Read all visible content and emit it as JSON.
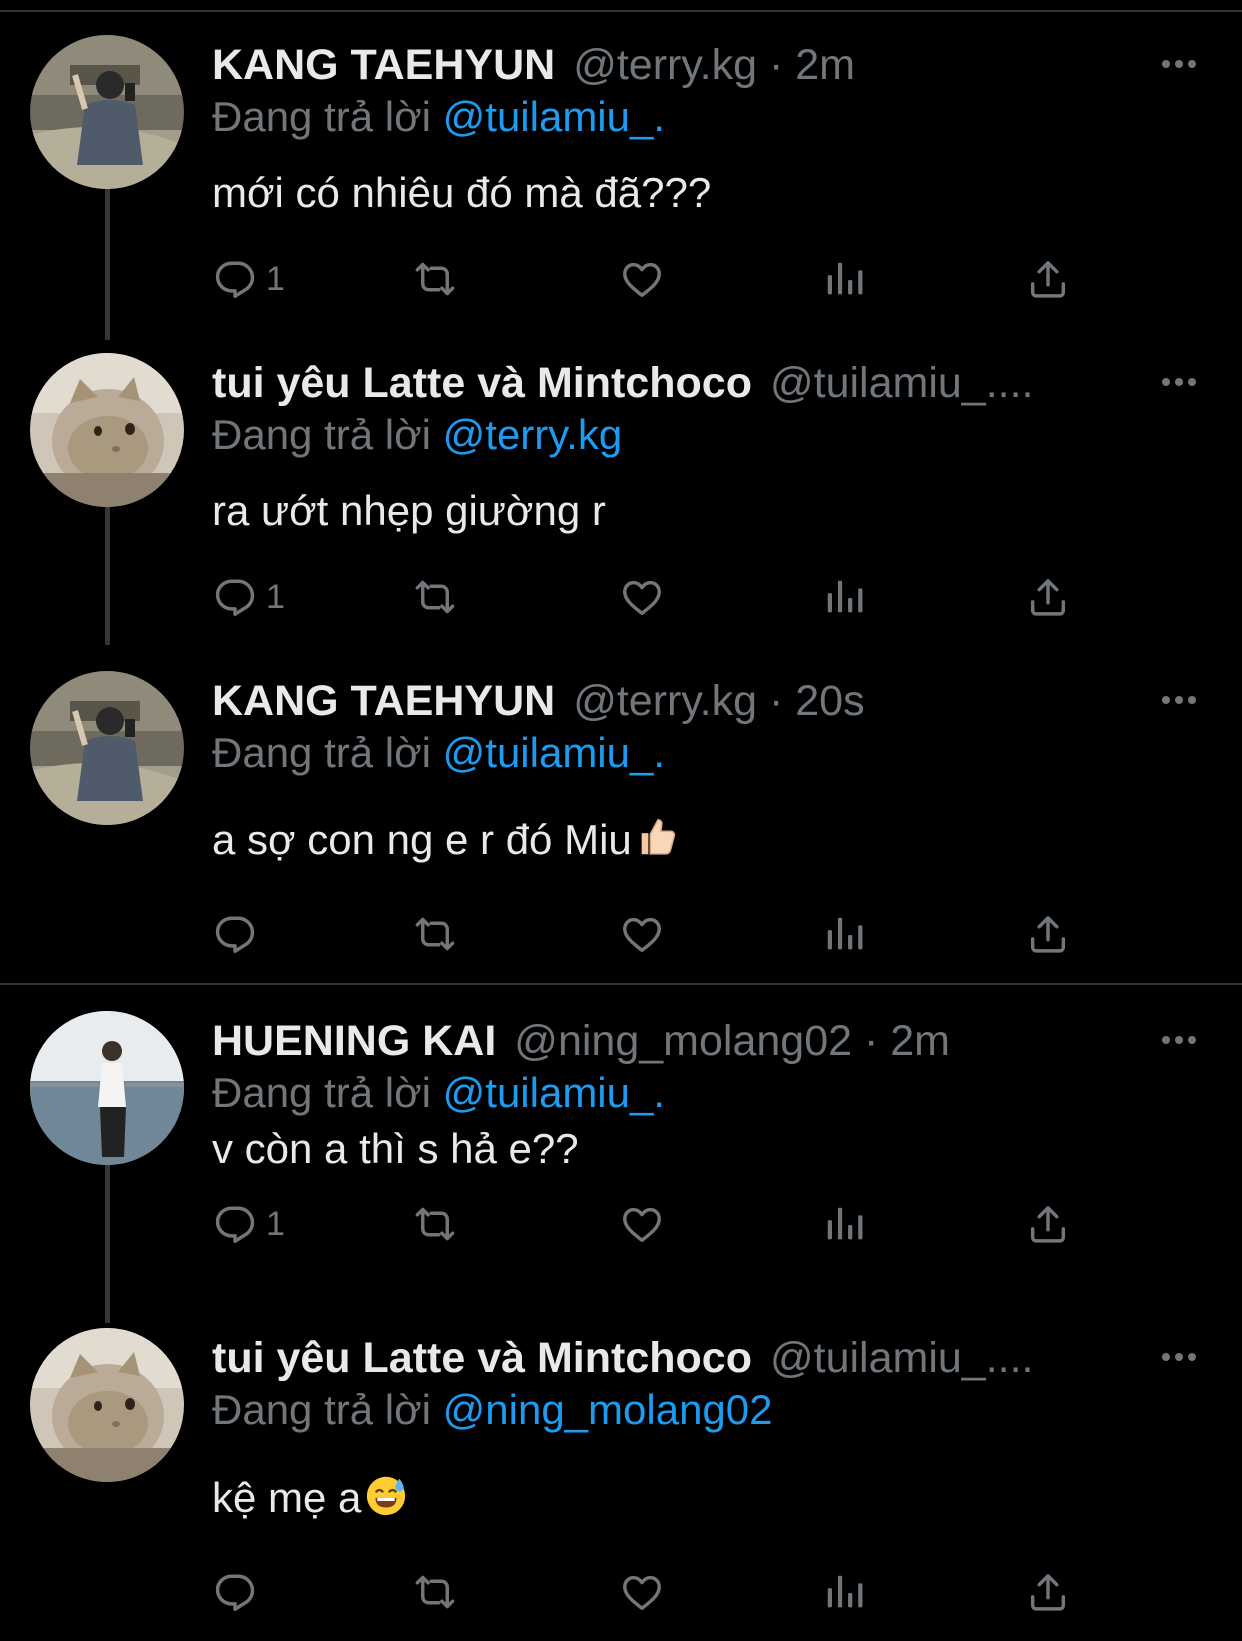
{
  "replying_label": "Đang trả lời",
  "tweets": [
    {
      "name": "KANG TAEHYUN",
      "handle_meta": "@terry.kg · 2m",
      "reply_to": "@tuilamiu_.",
      "text": "mới có nhiêu đó mà đã???",
      "emoji": "",
      "reply_count": "1",
      "avatar": "person-photo"
    },
    {
      "name": "tui yêu Latte và Mintchoco",
      "handle_meta": "@tuilamiu_....",
      "reply_to": "@terry.kg",
      "text": "ra ướt nhẹp giường r",
      "emoji": "",
      "reply_count": "1",
      "avatar": "cat-photo"
    },
    {
      "name": "KANG TAEHYUN",
      "handle_meta": "@terry.kg · 20s",
      "reply_to": "@tuilamiu_.",
      "text": "a sợ con ng e r đó Miu",
      "emoji": "thumbs-up-emoji",
      "reply_count": "",
      "avatar": "person-photo"
    },
    {
      "name": "HUENING KAI",
      "handle_meta": "@ning_molang02 · 2m",
      "reply_to": "@tuilamiu_.",
      "text": "v còn a thì s hả e??",
      "emoji": "",
      "reply_count": "1",
      "avatar": "beach-person-photo"
    },
    {
      "name": "tui yêu Latte và Mintchoco",
      "handle_meta": "@tuilamiu_....",
      "reply_to": "@ning_molang02",
      "text": "kệ mẹ a",
      "emoji": "sweat-smile-emoji",
      "reply_count": "",
      "avatar": "cat-photo"
    }
  ],
  "colors": {
    "background": "#000000",
    "text": "#e7e9ea",
    "secondary": "#71767b",
    "accent": "#1d9bf0",
    "divider": "#2f3336"
  }
}
